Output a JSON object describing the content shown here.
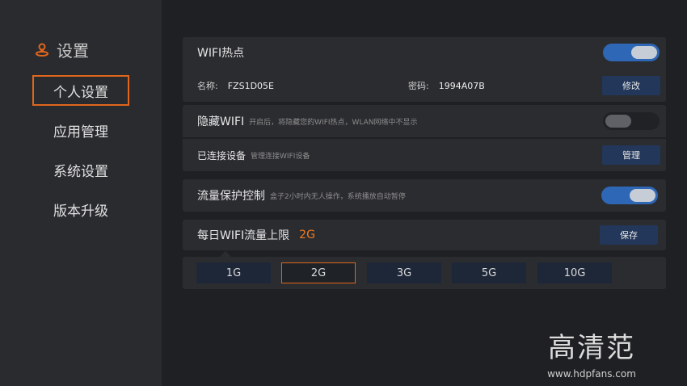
{
  "sidebar": {
    "title": "设置",
    "items": [
      {
        "label": "个人设置",
        "active": true
      },
      {
        "label": "应用管理",
        "active": false
      },
      {
        "label": "系统设置",
        "active": false
      },
      {
        "label": "版本升级",
        "active": false
      }
    ]
  },
  "wifi_hotspot": {
    "title": "WIFI热点",
    "enabled": true,
    "name_label": "名称:",
    "name_value": "FZS1D05E",
    "password_label": "密码:",
    "password_value": "1994A07B",
    "modify_button": "修改"
  },
  "hide_wifi": {
    "title": "隐藏WIFI",
    "hint": "开启后，将隐藏您的WIFI热点，WLAN网络中不显示",
    "enabled": false
  },
  "connected_devices": {
    "title": "已连接设备",
    "hint": "管理连接WIFI设备",
    "manage_button": "管理"
  },
  "traffic_protection": {
    "title": "流量保护控制",
    "hint": "盒子2小时内无人操作，系统播放自动暂停",
    "enabled": true
  },
  "daily_limit": {
    "title": "每日WIFI流量上限",
    "value": "2G",
    "save_button": "保存",
    "options": [
      "1G",
      "2G",
      "3G",
      "5G",
      "10G"
    ],
    "selected": "2G"
  },
  "watermark": {
    "logo_text": "高清范",
    "url": "www.hdpfans.com"
  },
  "colors": {
    "accent": "#e0661c",
    "toggle_on": "#2e67b5",
    "button_bg": "#22375a"
  }
}
